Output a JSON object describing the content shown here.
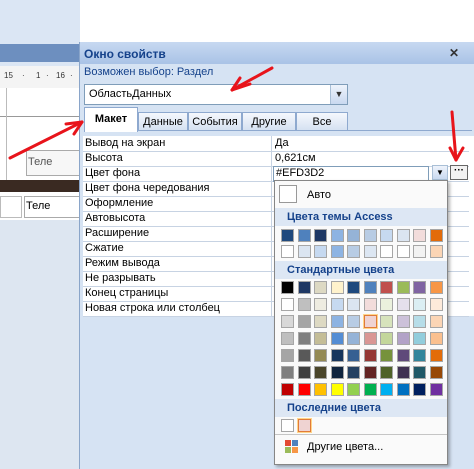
{
  "background": {
    "ruler_marks": [
      "15",
      "·",
      "1",
      "·",
      "16",
      "·"
    ],
    "cell_texts": [
      "Теле",
      "Теле"
    ]
  },
  "properties_window": {
    "title": "Окно свойств",
    "close_label": "✕",
    "selection_label": "Возможен выбор:  Раздел",
    "object_combo_value": "ОбластьДанных",
    "tabs": [
      {
        "label": "Макет",
        "active": true
      },
      {
        "label": "Данные",
        "active": false
      },
      {
        "label": "События",
        "active": false
      },
      {
        "label": "Другие",
        "active": false
      },
      {
        "label": "Все",
        "active": false
      }
    ],
    "rows": [
      {
        "label": "Вывод на экран",
        "value": "Да"
      },
      {
        "label": "Высота",
        "value": "0,621см"
      },
      {
        "label": "Цвет фона",
        "value": "#EFD3D2"
      },
      {
        "label": "Цвет фона чередования",
        "value": ""
      },
      {
        "label": "Оформление",
        "value": ""
      },
      {
        "label": "Автовысота",
        "value": ""
      },
      {
        "label": "Расширение",
        "value": ""
      },
      {
        "label": "Сжатие",
        "value": ""
      },
      {
        "label": "Режим вывода",
        "value": ""
      },
      {
        "label": "Не разрывать",
        "value": ""
      },
      {
        "label": "Конец страницы",
        "value": ""
      },
      {
        "label": "Новая строка или столбец",
        "value": ""
      }
    ],
    "builder_button_label": "···"
  },
  "color_picker": {
    "auto_label": "Авто",
    "theme_header": "Цвета темы Access",
    "standard_header": "Стандартные цвета",
    "recent_header": "Последние цвета",
    "more_label": "Другие цвета...",
    "theme_colors": [
      [
        "#1f497d",
        "#4f81bd",
        "#1f3864",
        "#8db3e2",
        "#95b3d7",
        "#b8cce4",
        "#c6d9f0",
        "#dbe5f1",
        "#f2dcdb",
        "#e26b0a"
      ],
      [
        "#ffffff",
        "#dbe5f1",
        "#c6d9f0",
        "#8eb4e3",
        "#b8cce4",
        "#dce6f2",
        "#ffffff",
        "#ffffff",
        "#f2f2f2",
        "#fbd5b5"
      ]
    ],
    "standard_colors": [
      [
        "#000000",
        "#1f3864",
        "#ddd9c3",
        "#fff2cc",
        "#1f497d",
        "#4f81bd",
        "#c0504d",
        "#9bbb59",
        "#8064a2",
        "#f79646"
      ],
      [
        "#ffffff",
        "#bfbfbf",
        "#eeece1",
        "#c6d9f0",
        "#dbe5f1",
        "#f2dcdb",
        "#ebf1dd",
        "#e5e0ec",
        "#dbeef3",
        "#fdeada"
      ],
      [
        "#d8d8d8",
        "#a5a5a5",
        "#ddd9c3",
        "#8db3e2",
        "#b8cce4",
        "#efd3d2",
        "#d7e3bc",
        "#ccc1d9",
        "#b7dde8",
        "#fbd5b5"
      ],
      [
        "#bfbfbf",
        "#7f7f7f",
        "#c4bd97",
        "#548dd4",
        "#95b3d7",
        "#d99694",
        "#c3d69b",
        "#b2a2c7",
        "#92cddc",
        "#fac08f"
      ],
      [
        "#a5a5a5",
        "#595959",
        "#948a54",
        "#17365d",
        "#366092",
        "#953734",
        "#76923c",
        "#5f497a",
        "#31859b",
        "#e36c09"
      ],
      [
        "#7f7f7f",
        "#3f3f3f",
        "#4a452a",
        "#0f243e",
        "#244061",
        "#632423",
        "#4f6228",
        "#3f3151",
        "#205867",
        "#974806"
      ],
      [
        "#c00000",
        "#ff0000",
        "#ffc000",
        "#ffff00",
        "#92d050",
        "#00b050",
        "#00b0f0",
        "#0070c0",
        "#002060",
        "#7030a0"
      ]
    ],
    "recent_colors": [
      "#ffffff",
      "#efd3d2"
    ],
    "selected_color": "#efd3d2",
    "annotation_arrow_color": "#e8141b"
  }
}
